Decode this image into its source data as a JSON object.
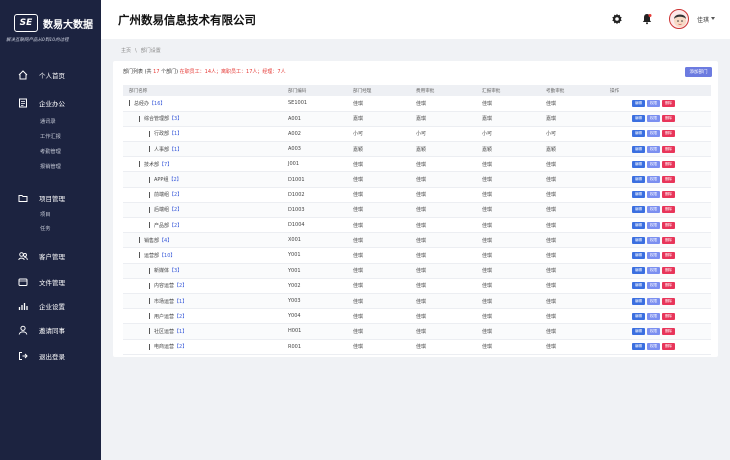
{
  "brand": {
    "mark": "SE",
    "name": "数易大数据",
    "slogan": "解决互联网产品从0到10的过程"
  },
  "sidebar": {
    "items": [
      {
        "label": "个人首页",
        "icon": "home-icon"
      },
      {
        "label": "企业办公",
        "icon": "document-icon",
        "children": [
          "通讯录",
          "工作汇报",
          "考勤管理",
          "报销管理"
        ]
      },
      {
        "label": "项目管理",
        "icon": "folder-icon",
        "children": [
          "项目",
          "任务"
        ]
      },
      {
        "label": "客户管理",
        "icon": "users-icon"
      },
      {
        "label": "文件管理",
        "icon": "file-icon"
      },
      {
        "label": "企业设置",
        "icon": "bar-chart-icon"
      },
      {
        "label": "邀请同事",
        "icon": "user-icon"
      },
      {
        "label": "退出登录",
        "icon": "logout-icon"
      }
    ]
  },
  "header": {
    "company": "广州数易信息技术有限公司",
    "user_name": "佳琪",
    "icons": [
      "gear-icon",
      "bell-icon",
      "avatar"
    ]
  },
  "breadcrumb": [
    "主页",
    "部门设置"
  ],
  "summary": {
    "prefix": "部门列表 (共",
    "count": "17",
    "mid": "个部门)",
    "stats": "在职员工：14人；离职员工：17人；经理：7人",
    "add_button": "添加部门"
  },
  "table": {
    "headers": [
      "部门名称",
      "部门编码",
      "部门经理",
      "费用审批",
      "汇报审批",
      "考勤审批",
      "操作"
    ],
    "rows": [
      {
        "indent": 0,
        "name": "总经办",
        "count": "【16】",
        "code": "SE1001",
        "manager": "佳琪",
        "expense": "佳琪",
        "report": "佳琪",
        "attendance": "佳琪"
      },
      {
        "indent": 1,
        "name": "综合管理部",
        "count": "【3】",
        "code": "A001",
        "manager": "嘉琪",
        "expense": "嘉琪",
        "report": "嘉琪",
        "attendance": "嘉琪"
      },
      {
        "indent": 2,
        "name": "行政部",
        "count": "【1】",
        "code": "A002",
        "manager": "小可",
        "expense": "小可",
        "report": "小可",
        "attendance": "小可"
      },
      {
        "indent": 2,
        "name": "人事部",
        "count": "【1】",
        "code": "A003",
        "manager": "嘉颖",
        "expense": "嘉颖",
        "report": "嘉颖",
        "attendance": "嘉颖"
      },
      {
        "indent": 1,
        "name": "技术部",
        "count": "【7】",
        "code": "J001",
        "manager": "佳琪",
        "expense": "佳琪",
        "report": "佳琪",
        "attendance": "佳琪"
      },
      {
        "indent": 2,
        "name": "APP组",
        "count": "【2】",
        "code": "D1001",
        "manager": "佳琪",
        "expense": "佳琪",
        "report": "佳琪",
        "attendance": "佳琪"
      },
      {
        "indent": 2,
        "name": "前端组",
        "count": "【2】",
        "code": "D1002",
        "manager": "佳琪",
        "expense": "佳琪",
        "report": "佳琪",
        "attendance": "佳琪"
      },
      {
        "indent": 2,
        "name": "后端组",
        "count": "【2】",
        "code": "D1003",
        "manager": "佳琪",
        "expense": "佳琪",
        "report": "佳琪",
        "attendance": "佳琪"
      },
      {
        "indent": 2,
        "name": "产品部",
        "count": "【2】",
        "code": "D1004",
        "manager": "佳琪",
        "expense": "佳琪",
        "report": "佳琪",
        "attendance": "佳琪"
      },
      {
        "indent": 1,
        "name": "销售部",
        "count": "【4】",
        "code": "X001",
        "manager": "佳琪",
        "expense": "佳琪",
        "report": "佳琪",
        "attendance": "佳琪"
      },
      {
        "indent": 1,
        "name": "运营部",
        "count": "【10】",
        "code": "Y001",
        "manager": "佳琪",
        "expense": "佳琪",
        "report": "佳琪",
        "attendance": "佳琪"
      },
      {
        "indent": 2,
        "name": "新媒体",
        "count": "【3】",
        "code": "Y001",
        "manager": "佳琪",
        "expense": "佳琪",
        "report": "佳琪",
        "attendance": "佳琪"
      },
      {
        "indent": 2,
        "name": "内容运营",
        "count": "【2】",
        "code": "Y002",
        "manager": "佳琪",
        "expense": "佳琪",
        "report": "佳琪",
        "attendance": "佳琪"
      },
      {
        "indent": 2,
        "name": "市场运营",
        "count": "【1】",
        "code": "Y003",
        "manager": "佳琪",
        "expense": "佳琪",
        "report": "佳琪",
        "attendance": "佳琪"
      },
      {
        "indent": 2,
        "name": "用户运营",
        "count": "【2】",
        "code": "Y004",
        "manager": "佳琪",
        "expense": "佳琪",
        "report": "佳琪",
        "attendance": "佳琪"
      },
      {
        "indent": 2,
        "name": "社区运营",
        "count": "【1】",
        "code": "H001",
        "manager": "佳琪",
        "expense": "佳琪",
        "report": "佳琪",
        "attendance": "佳琪"
      },
      {
        "indent": 2,
        "name": "电商运营",
        "count": "【2】",
        "code": "R001",
        "manager": "佳琪",
        "expense": "佳琪",
        "report": "佳琪",
        "attendance": "佳琪"
      }
    ],
    "actions": [
      "编辑",
      "权限",
      "删除"
    ]
  },
  "colors": {
    "sidebar_bg": "#1c2340",
    "accent": "#3b6fe0",
    "danger": "#e8355a",
    "highlight": "#e53935"
  }
}
